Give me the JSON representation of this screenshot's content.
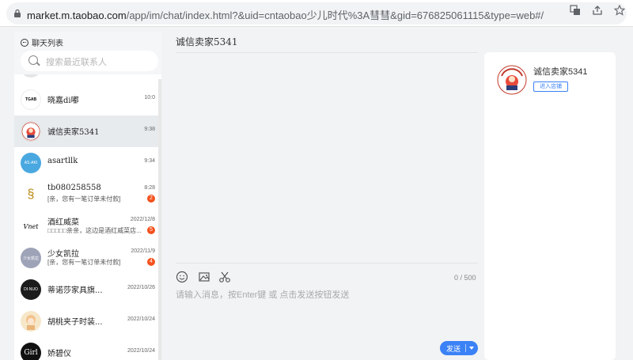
{
  "browser": {
    "url_host": "market.m.taobao.com",
    "url_rest": "/app/im/chat/index.html?&uid=cntaobao少儿时代%3A彗彗&gid=676825061115&type=web#/"
  },
  "sidebar": {
    "title": "聊天列表",
    "search_placeholder": "搜索最近联系人",
    "contacts": [
      {
        "name": "晓嘉di嘟",
        "time": "10:0",
        "avatar_text": "TGAB",
        "avatar_color": "#ffffff",
        "avatar_fg": "#000000"
      },
      {
        "name": "诚信卖家5341",
        "time": "9:38",
        "avatar_text": "",
        "avatar_color": "#ffffff",
        "avatar_fg": "#c0392b",
        "active": true
      },
      {
        "name": "asartllk",
        "time": "9:34",
        "avatar_text": "AS·AKI",
        "avatar_color": "#4aa8e0",
        "avatar_fg": "#ffffff"
      },
      {
        "name": "tb080258558",
        "time": "8:28",
        "message": "[亲，您有一笔订单未付款]",
        "badge": "2",
        "avatar_text": "§",
        "avatar_color": "#ffffff",
        "avatar_fg": "#b8860b"
      },
      {
        "name": "酒红威菜",
        "time": "2022/12/8",
        "message": "□□□□□亲亲，这边是酒红威菜店...",
        "badge": "5",
        "avatar_text": "Vnet",
        "avatar_color": "#ffffff",
        "avatar_fg": "#000000"
      },
      {
        "name": "少女凯拉",
        "time": "2022/11/9",
        "message": "[亲，您有一笔订单未付款]",
        "badge": "4",
        "avatar_text": "少女凯拉",
        "avatar_color": "#9ea3b8",
        "avatar_fg": "#ffffff"
      },
      {
        "name": "蒂诺莎家具旗...",
        "time": "2022/10/26",
        "avatar_text": "DI·NUO",
        "avatar_color": "#1c1c1c",
        "avatar_fg": "#ffffff"
      },
      {
        "name": "胡桃夹子时装...",
        "time": "2022/10/24",
        "avatar_text": "",
        "avatar_color": "#f6e7c9",
        "avatar_fg": "#c58b3a"
      },
      {
        "name": "娇碧仪",
        "time": "2022/10/24",
        "avatar_text": "Girl",
        "avatar_color": "#111111",
        "avatar_fg": "#ffffff"
      }
    ]
  },
  "chat": {
    "title": "诚信卖家5341",
    "counter": "0 / 500",
    "placeholder": "请输入消息，按Enter键 或 点击发送按钮发送",
    "send_label": "发送"
  },
  "shop": {
    "name": "诚信卖家5341",
    "enter_label": "进入店铺"
  }
}
